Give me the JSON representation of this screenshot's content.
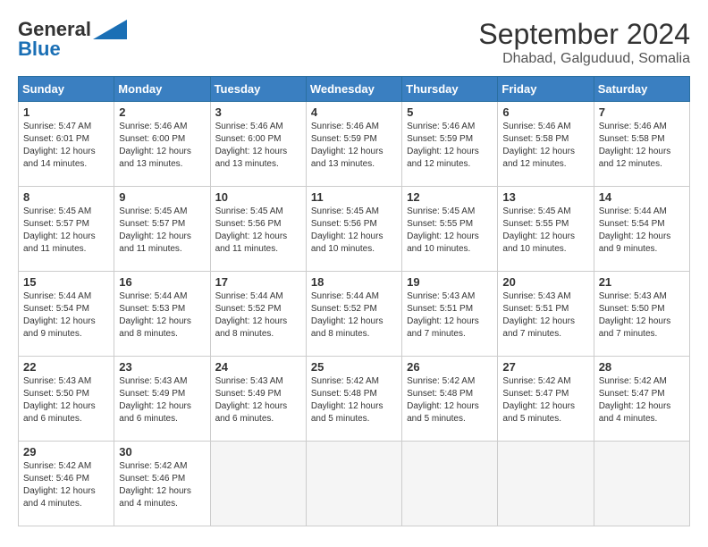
{
  "header": {
    "logo_general": "General",
    "logo_blue": "Blue",
    "month": "September 2024",
    "location": "Dhabad, Galguduud, Somalia"
  },
  "weekdays": [
    "Sunday",
    "Monday",
    "Tuesday",
    "Wednesday",
    "Thursday",
    "Friday",
    "Saturday"
  ],
  "weeks": [
    [
      {
        "day": 1,
        "sunrise": "5:47 AM",
        "sunset": "6:01 PM",
        "daylight": "12 hours and 14 minutes."
      },
      {
        "day": 2,
        "sunrise": "5:46 AM",
        "sunset": "6:00 PM",
        "daylight": "12 hours and 13 minutes."
      },
      {
        "day": 3,
        "sunrise": "5:46 AM",
        "sunset": "6:00 PM",
        "daylight": "12 hours and 13 minutes."
      },
      {
        "day": 4,
        "sunrise": "5:46 AM",
        "sunset": "5:59 PM",
        "daylight": "12 hours and 13 minutes."
      },
      {
        "day": 5,
        "sunrise": "5:46 AM",
        "sunset": "5:59 PM",
        "daylight": "12 hours and 12 minutes."
      },
      {
        "day": 6,
        "sunrise": "5:46 AM",
        "sunset": "5:58 PM",
        "daylight": "12 hours and 12 minutes."
      },
      {
        "day": 7,
        "sunrise": "5:46 AM",
        "sunset": "5:58 PM",
        "daylight": "12 hours and 12 minutes."
      }
    ],
    [
      {
        "day": 8,
        "sunrise": "5:45 AM",
        "sunset": "5:57 PM",
        "daylight": "12 hours and 11 minutes."
      },
      {
        "day": 9,
        "sunrise": "5:45 AM",
        "sunset": "5:57 PM",
        "daylight": "12 hours and 11 minutes."
      },
      {
        "day": 10,
        "sunrise": "5:45 AM",
        "sunset": "5:56 PM",
        "daylight": "12 hours and 11 minutes."
      },
      {
        "day": 11,
        "sunrise": "5:45 AM",
        "sunset": "5:56 PM",
        "daylight": "12 hours and 10 minutes."
      },
      {
        "day": 12,
        "sunrise": "5:45 AM",
        "sunset": "5:55 PM",
        "daylight": "12 hours and 10 minutes."
      },
      {
        "day": 13,
        "sunrise": "5:45 AM",
        "sunset": "5:55 PM",
        "daylight": "12 hours and 10 minutes."
      },
      {
        "day": 14,
        "sunrise": "5:44 AM",
        "sunset": "5:54 PM",
        "daylight": "12 hours and 9 minutes."
      }
    ],
    [
      {
        "day": 15,
        "sunrise": "5:44 AM",
        "sunset": "5:54 PM",
        "daylight": "12 hours and 9 minutes."
      },
      {
        "day": 16,
        "sunrise": "5:44 AM",
        "sunset": "5:53 PM",
        "daylight": "12 hours and 8 minutes."
      },
      {
        "day": 17,
        "sunrise": "5:44 AM",
        "sunset": "5:52 PM",
        "daylight": "12 hours and 8 minutes."
      },
      {
        "day": 18,
        "sunrise": "5:44 AM",
        "sunset": "5:52 PM",
        "daylight": "12 hours and 8 minutes."
      },
      {
        "day": 19,
        "sunrise": "5:43 AM",
        "sunset": "5:51 PM",
        "daylight": "12 hours and 7 minutes."
      },
      {
        "day": 20,
        "sunrise": "5:43 AM",
        "sunset": "5:51 PM",
        "daylight": "12 hours and 7 minutes."
      },
      {
        "day": 21,
        "sunrise": "5:43 AM",
        "sunset": "5:50 PM",
        "daylight": "12 hours and 7 minutes."
      }
    ],
    [
      {
        "day": 22,
        "sunrise": "5:43 AM",
        "sunset": "5:50 PM",
        "daylight": "12 hours and 6 minutes."
      },
      {
        "day": 23,
        "sunrise": "5:43 AM",
        "sunset": "5:49 PM",
        "daylight": "12 hours and 6 minutes."
      },
      {
        "day": 24,
        "sunrise": "5:43 AM",
        "sunset": "5:49 PM",
        "daylight": "12 hours and 6 minutes."
      },
      {
        "day": 25,
        "sunrise": "5:42 AM",
        "sunset": "5:48 PM",
        "daylight": "12 hours and 5 minutes."
      },
      {
        "day": 26,
        "sunrise": "5:42 AM",
        "sunset": "5:48 PM",
        "daylight": "12 hours and 5 minutes."
      },
      {
        "day": 27,
        "sunrise": "5:42 AM",
        "sunset": "5:47 PM",
        "daylight": "12 hours and 5 minutes."
      },
      {
        "day": 28,
        "sunrise": "5:42 AM",
        "sunset": "5:47 PM",
        "daylight": "12 hours and 4 minutes."
      }
    ],
    [
      {
        "day": 29,
        "sunrise": "5:42 AM",
        "sunset": "5:46 PM",
        "daylight": "12 hours and 4 minutes."
      },
      {
        "day": 30,
        "sunrise": "5:42 AM",
        "sunset": "5:46 PM",
        "daylight": "12 hours and 4 minutes."
      },
      null,
      null,
      null,
      null,
      null
    ]
  ]
}
